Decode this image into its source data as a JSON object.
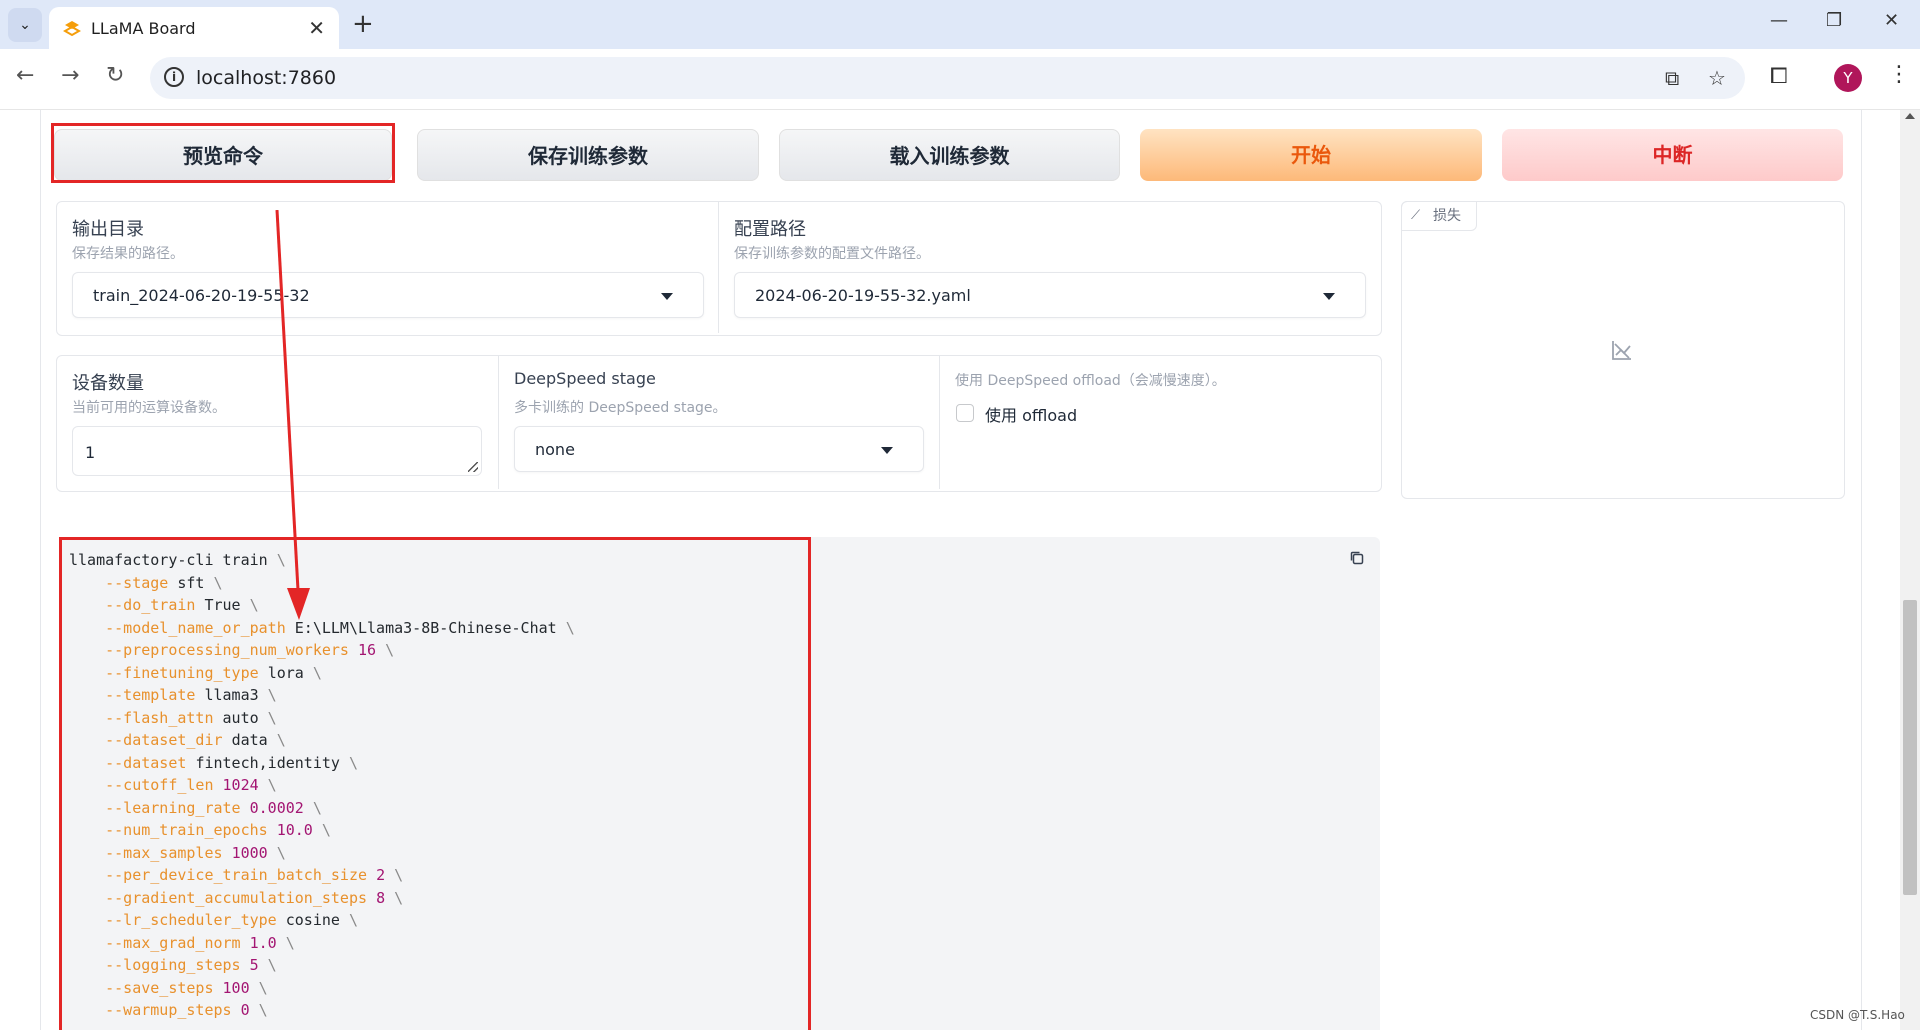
{
  "browser": {
    "tab_title": "LLaMA Board",
    "tab_close": "✕",
    "new_tab": "+",
    "url": "localhost:7860",
    "avatar_letter": "Y"
  },
  "actions": {
    "preview": "预览命令",
    "save": "保存训练参数",
    "load": "载入训练参数",
    "start": "开始",
    "stop": "中断"
  },
  "output_dir": {
    "label": "输出目录",
    "info": "保存结果的路径。",
    "value": "train_2024-06-20-19-55-32"
  },
  "config_path": {
    "label": "配置路径",
    "info": "保存训练参数的配置文件路径。",
    "value": "2024-06-20-19-55-32.yaml"
  },
  "device_count": {
    "label": "设备数量",
    "info": "当前可用的运算设备数。",
    "value": "1"
  },
  "ds_stage": {
    "label": "DeepSpeed stage",
    "info": "多卡训练的 DeepSpeed stage。",
    "value": "none"
  },
  "ds_offload": {
    "info": "使用 DeepSpeed offload（会减慢速度）。",
    "checkbox_label": "使用 offload",
    "checked": false
  },
  "loss_plot": {
    "label": "损失"
  },
  "command": {
    "head": "llamafactory-cli train",
    "args": [
      {
        "flag": "--stage",
        "value": "sft",
        "numeric": false
      },
      {
        "flag": "--do_train",
        "value": "True",
        "numeric": false
      },
      {
        "flag": "--model_name_or_path",
        "value": "E:\\LLM\\Llama3-8B-Chinese-Chat",
        "numeric": false
      },
      {
        "flag": "--preprocessing_num_workers",
        "value": "16",
        "numeric": true
      },
      {
        "flag": "--finetuning_type",
        "value": "lora",
        "numeric": false
      },
      {
        "flag": "--template",
        "value": "llama3",
        "numeric": false
      },
      {
        "flag": "--flash_attn",
        "value": "auto",
        "numeric": false
      },
      {
        "flag": "--dataset_dir",
        "value": "data",
        "numeric": false
      },
      {
        "flag": "--dataset",
        "value": "fintech,identity",
        "numeric": false
      },
      {
        "flag": "--cutoff_len",
        "value": "1024",
        "numeric": true
      },
      {
        "flag": "--learning_rate",
        "value": "0.0002",
        "numeric": true
      },
      {
        "flag": "--num_train_epochs",
        "value": "10.0",
        "numeric": true
      },
      {
        "flag": "--max_samples",
        "value": "1000",
        "numeric": true
      },
      {
        "flag": "--per_device_train_batch_size",
        "value": "2",
        "numeric": true
      },
      {
        "flag": "--gradient_accumulation_steps",
        "value": "8",
        "numeric": true
      },
      {
        "flag": "--lr_scheduler_type",
        "value": "cosine",
        "numeric": false
      },
      {
        "flag": "--max_grad_norm",
        "value": "1.0",
        "numeric": true
      },
      {
        "flag": "--logging_steps",
        "value": "5",
        "numeric": true
      },
      {
        "flag": "--save_steps",
        "value": "100",
        "numeric": true
      },
      {
        "flag": "--warmup_steps",
        "value": "0",
        "numeric": true
      }
    ]
  },
  "watermark": "CSDN @T.S.Hao",
  "colors": {
    "highlight": "#e32626",
    "start_text": "#ea580c",
    "stop_text": "#dc2626",
    "flag": "#e8912d",
    "number": "#a31572"
  }
}
